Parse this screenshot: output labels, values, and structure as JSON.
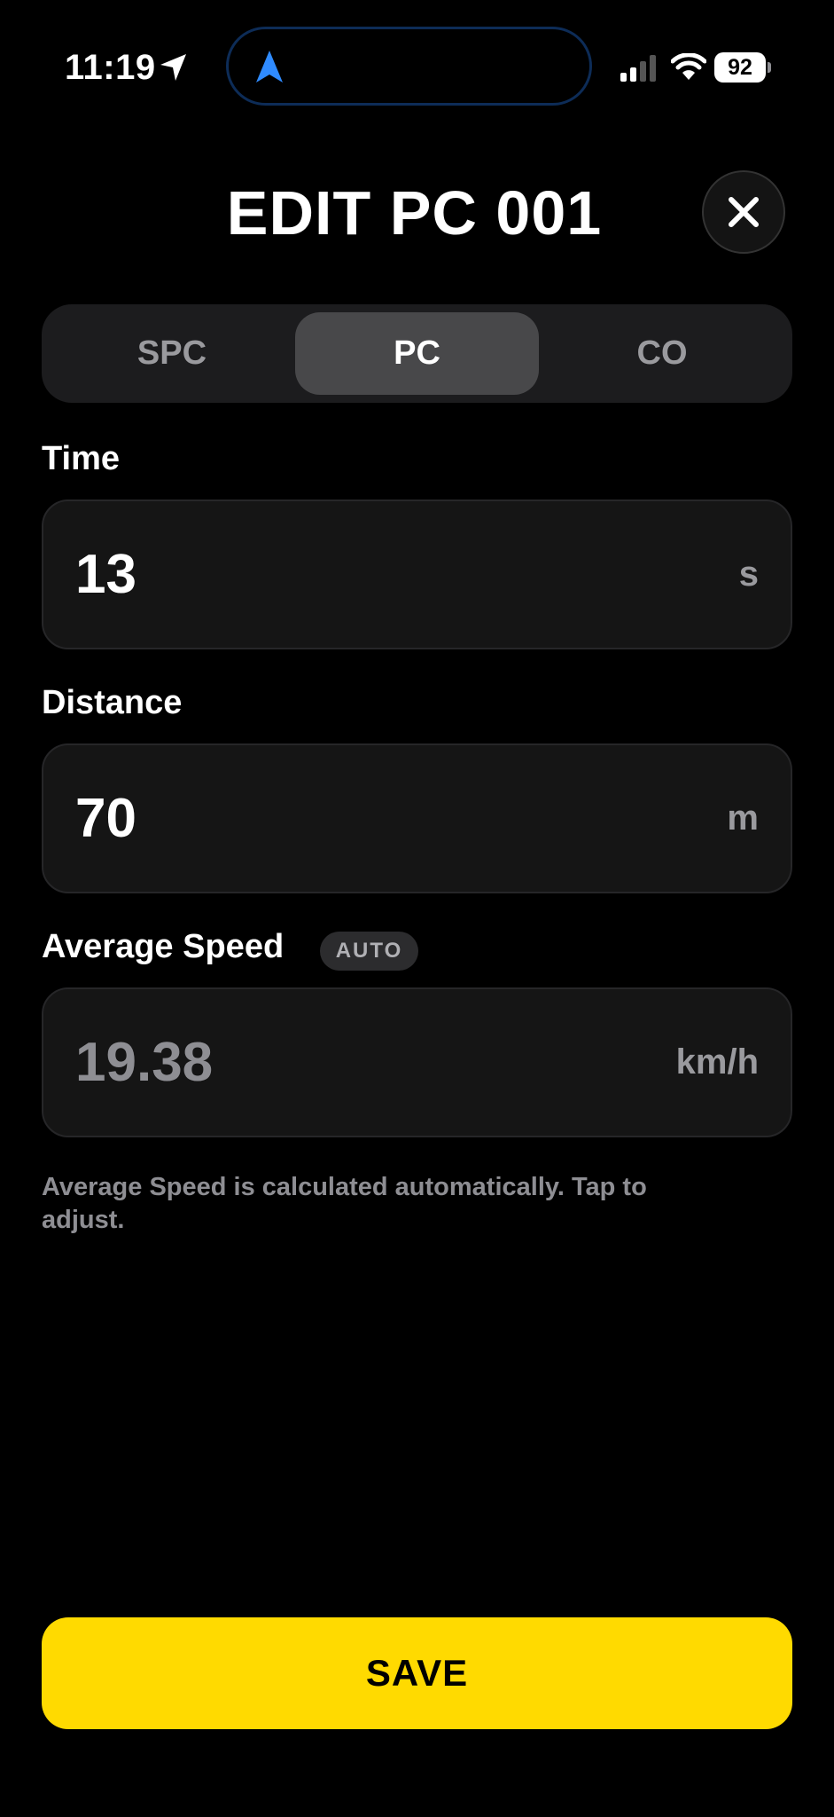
{
  "status_bar": {
    "time": "11:19",
    "battery": "92"
  },
  "header": {
    "title": "EDIT PC 001"
  },
  "segments": [
    {
      "label": "SPC",
      "active": false
    },
    {
      "label": "PC",
      "active": true
    },
    {
      "label": "CO",
      "active": false
    }
  ],
  "fields": {
    "time": {
      "label": "Time",
      "value": "13",
      "unit": "s"
    },
    "distance": {
      "label": "Distance",
      "value": "70",
      "unit": "m"
    },
    "average_speed": {
      "label": "Average Speed",
      "badge": "AUTO",
      "value": "19.38",
      "unit": "km/h"
    }
  },
  "hint": "Average Speed is calculated automatically. Tap to adjust.",
  "save_label": "SAVE",
  "colors": {
    "accent": "#ffda00",
    "background": "#000000",
    "island_nav": "#2f8bff"
  }
}
